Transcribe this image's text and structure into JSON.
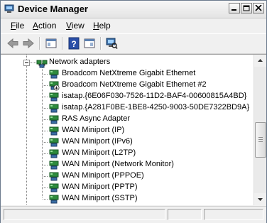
{
  "window": {
    "title": "Device Manager"
  },
  "menu": [
    {
      "hotkey": "F",
      "rest": "ile"
    },
    {
      "hotkey": "A",
      "rest": "ction"
    },
    {
      "hotkey": "V",
      "rest": "iew"
    },
    {
      "hotkey": "H",
      "rest": "elp"
    }
  ],
  "tree": {
    "category": "Network adapters",
    "devices": [
      "Broadcom NetXtreme Gigabit Ethernet",
      "Broadcom NetXtreme Gigabit Ethernet #2",
      "isatap.{6E06F030-7526-11D2-BAF4-00600815A4BD}",
      "isatap.{A281F0BE-1BE8-4250-9003-50DE7322BD9A}",
      "RAS Async Adapter",
      "WAN Miniport (IP)",
      "WAN Miniport (IPv6)",
      "WAN Miniport (L2TP)",
      "WAN Miniport (Network Monitor)",
      "WAN Miniport (PPPOE)",
      "WAN Miniport (PPTP)",
      "WAN Miniport (SSTP)"
    ]
  },
  "icons": {
    "app": "device-manager-icon",
    "back": "back-arrow-icon",
    "forward": "forward-arrow-icon",
    "console_tree": "console-tree-icon",
    "help": "help-icon",
    "properties": "properties-icon",
    "scan": "scan-hardware-icon",
    "network": "network-adapter-icon",
    "warning": "warning-badge-icon"
  }
}
